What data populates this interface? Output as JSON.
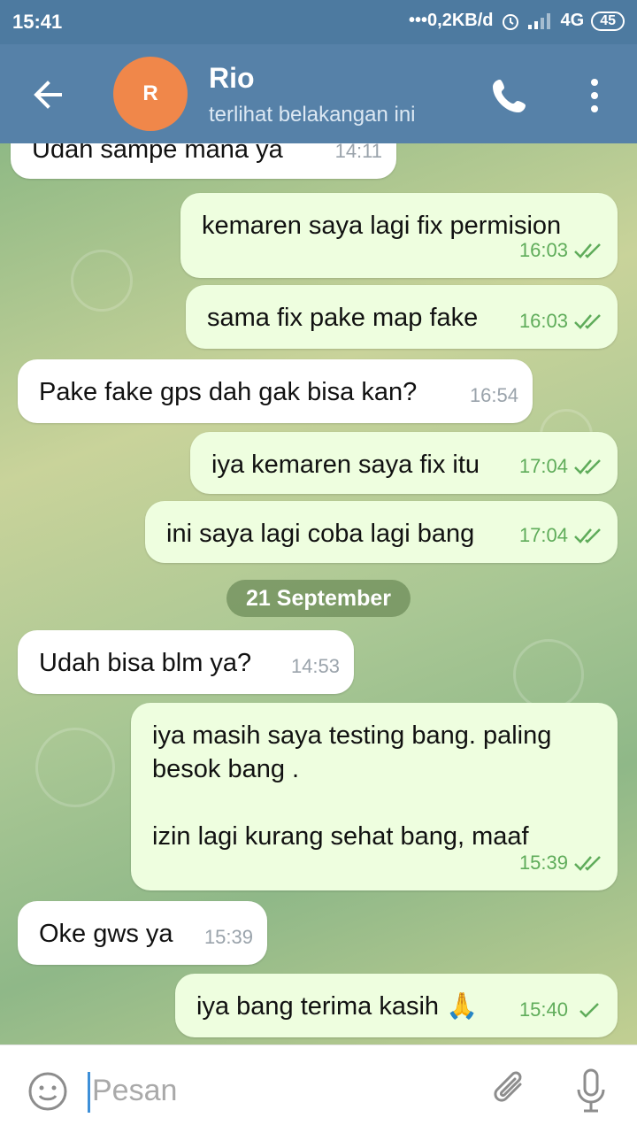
{
  "status_bar": {
    "time": "15:41",
    "network": "•••0,2KB/d",
    "net_type": "4G",
    "battery": "45",
    "icons": [
      "alarm-icon",
      "signal-icon"
    ]
  },
  "header": {
    "avatar_letter": "R",
    "title": "Rio",
    "subtitle": "terlihat belakangan ini",
    "icons": [
      "back-arrow-icon",
      "phone-icon",
      "more-vertical-icon"
    ],
    "accent": "#5681a8",
    "avatar_color": "#f0874a"
  },
  "messages": [
    {
      "text": "Udah sampe mana ya",
      "time": "14:11",
      "dir": "in"
    },
    {
      "text": "kemaren saya lagi fix permision",
      "time": "16:03",
      "dir": "out",
      "status": "read"
    },
    {
      "text": "sama fix pake map fake",
      "time": "16:03",
      "dir": "out",
      "status": "read"
    },
    {
      "text": "Pake fake gps dah gak bisa kan?",
      "time": "16:54",
      "dir": "in"
    },
    {
      "text": "iya kemaren saya fix itu",
      "time": "17:04",
      "dir": "out",
      "status": "read"
    },
    {
      "text": "ini saya lagi coba lagi bang",
      "time": "17:04",
      "dir": "out",
      "status": "read"
    },
    {
      "text": "Udah bisa blm ya?",
      "time": "14:53",
      "dir": "in"
    },
    {
      "text": "iya masih saya testing bang. paling\nbesok bang .\n\nizin lagi kurang sehat bang, maaf",
      "time": "15:39",
      "dir": "out",
      "status": "read"
    },
    {
      "text": "Oke gws ya",
      "time": "15:39",
      "dir": "in"
    },
    {
      "text": "iya bang terima kasih 🙏",
      "time": "15:40",
      "dir": "out",
      "status": "sent"
    }
  ],
  "date_separator": "21 September",
  "input": {
    "placeholder": "Pesan",
    "value": "",
    "icons": [
      "emoji-icon",
      "attach-icon",
      "mic-icon"
    ]
  },
  "colors": {
    "incoming_bubble": "#ffffff",
    "outgoing_bubble": "#eefedf",
    "check_color": "#5fac5a"
  }
}
